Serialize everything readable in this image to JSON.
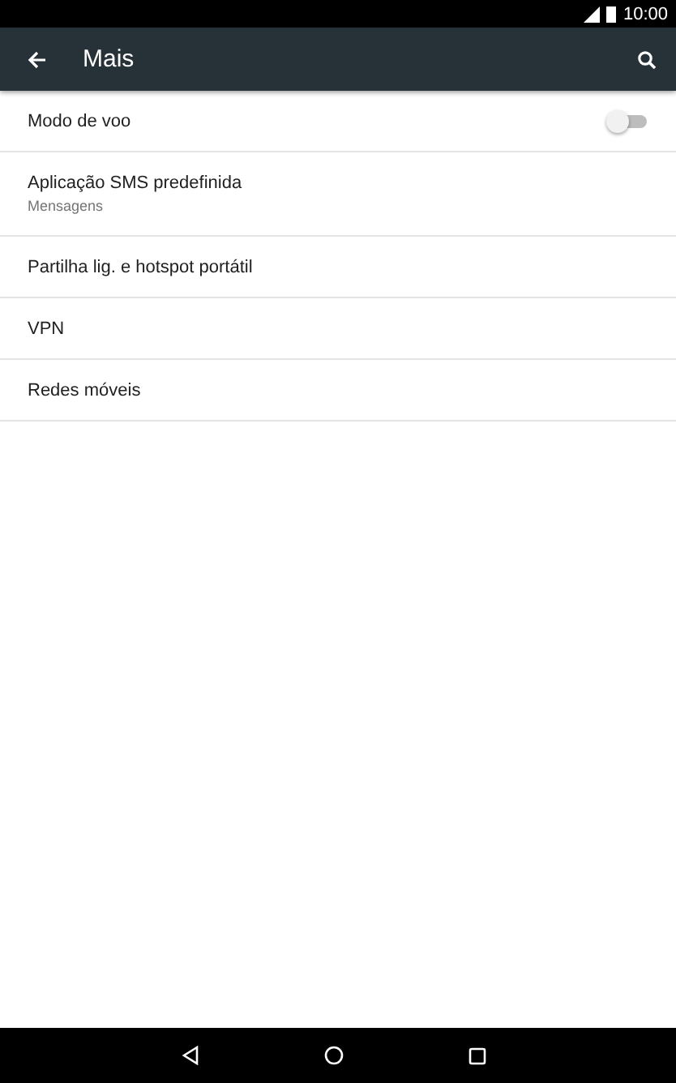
{
  "status_bar": {
    "time": "10:00"
  },
  "app_bar": {
    "title": "Mais"
  },
  "items": [
    {
      "kind": "switch",
      "label": "Modo de voo",
      "on": false
    },
    {
      "kind": "text",
      "label": "Aplicação SMS predefinida",
      "summary": "Mensagens"
    },
    {
      "kind": "text",
      "label": "Partilha lig. e hotspot portátil"
    },
    {
      "kind": "text",
      "label": "VPN"
    },
    {
      "kind": "text",
      "label": "Redes móveis"
    }
  ]
}
